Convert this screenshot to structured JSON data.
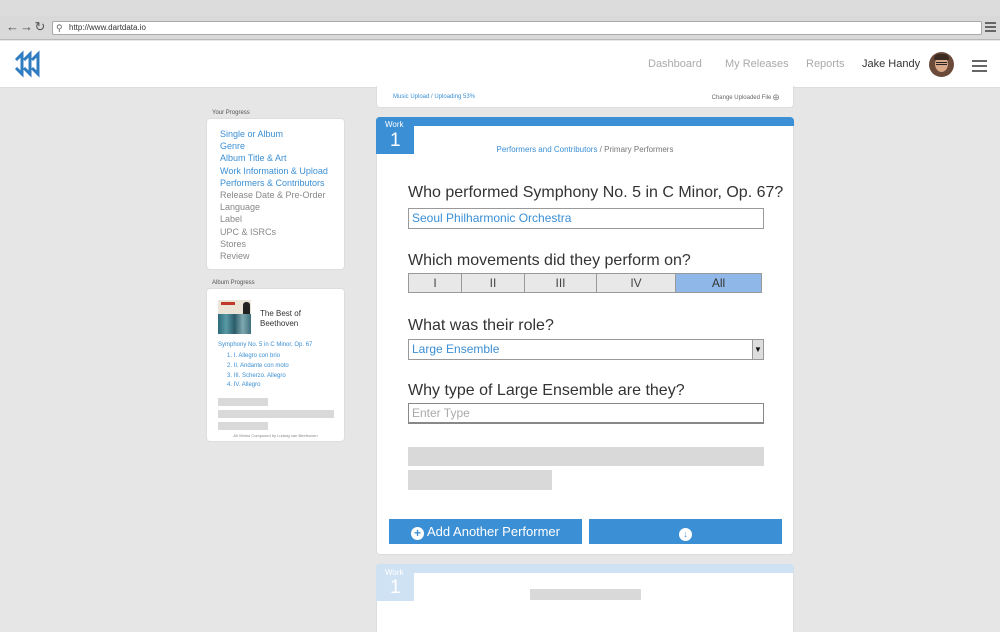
{
  "browser": {
    "url": "http://www.dartdata.io"
  },
  "header": {
    "nav": [
      "Dashboard",
      "My Releases",
      "Reports"
    ],
    "user_name": "Jake Handy"
  },
  "progress": {
    "title": "Your Progress",
    "steps": [
      {
        "label": "Single or Album",
        "done": true
      },
      {
        "label": "Genre",
        "done": true
      },
      {
        "label": "Album Title & Art",
        "done": true
      },
      {
        "label": "Work Information & Upload",
        "done": true
      },
      {
        "label": "Performers & Contributors",
        "done": true
      },
      {
        "label": "Release Date & Pre-Order",
        "done": false
      },
      {
        "label": "Language",
        "done": false
      },
      {
        "label": "Label",
        "done": false
      },
      {
        "label": "UPC & ISRCs",
        "done": false
      },
      {
        "label": "Stores",
        "done": false
      },
      {
        "label": "Review",
        "done": false
      }
    ]
  },
  "album": {
    "section_title": "Album Progress",
    "title": "The Best of Beethoven",
    "work": "Symphony No. 5 in C Minor, Op. 67",
    "movements": [
      "1. I. Allegro con brio",
      "2. II. Andante con moto",
      "3. III. Scherzo. Allegro",
      "4. IV. Allegro"
    ],
    "footer": "All Works Composed by Ludwig van Beethoven"
  },
  "upload": {
    "status": "Music Upload / Uploading 53%",
    "change_label": "Change Uploaded File"
  },
  "work": {
    "tab_label": "Work",
    "number": "1",
    "breadcrumb_link": "Performers and Contributors",
    "breadcrumb_sep": " / ",
    "breadcrumb_current": "Primary Performers",
    "q_performer": "Who performed Symphony No. 5 in C Minor, Op. 67?",
    "performer_value": "Seoul Philharmonic Orchestra",
    "q_movements": "Which movements did they perform on?",
    "movements": [
      "I",
      "II",
      "III",
      "IV",
      "All"
    ],
    "selected_movement": "All",
    "q_role": "What was their role?",
    "role_value": "Large Ensemble",
    "q_type": "Why type of Large Ensemble are they?",
    "type_placeholder": "Enter Type",
    "add_performer_label": "Add Another Performer"
  },
  "work2": {
    "tab_label": "Work",
    "number": "1"
  },
  "colors": {
    "accent": "#3b8fd4",
    "selected_segment": "#8fb8e8"
  }
}
